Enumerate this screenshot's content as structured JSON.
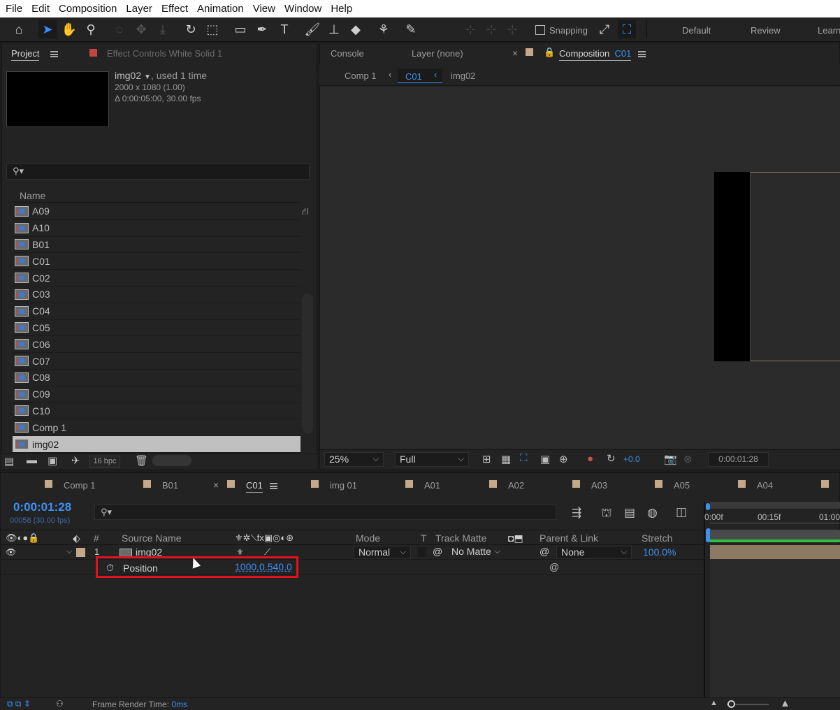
{
  "menu": [
    "File",
    "Edit",
    "Composition",
    "Layer",
    "Effect",
    "Animation",
    "View",
    "Window",
    "Help"
  ],
  "toolbar": {
    "snapping_label": "Snapping",
    "workspaces": [
      "Default",
      "Review",
      "Learn"
    ]
  },
  "project_panel": {
    "tab_label": "Project",
    "effect_controls_tab": "Effect Controls",
    "effect_controls_layer": "White Solid 1",
    "item_name": "img02",
    "item_usage": ", used 1 time",
    "item_dims": "2000 x 1080 (1.00)",
    "item_duration": "Δ 0:00:05:00, 30.00 fps",
    "name_header": "Name",
    "items": [
      "A09",
      "A10",
      "B01",
      "C01",
      "C02",
      "C03",
      "C04",
      "C05",
      "C06",
      "C07",
      "C08",
      "C09",
      "C10",
      "Comp 1",
      "img02"
    ],
    "selected_index": 14,
    "bpc_label": "16 bpc"
  },
  "viewer_panel": {
    "tabs": [
      "Console",
      "Layer (none)"
    ],
    "comp_tab_prefix": "Composition",
    "comp_tab_name": "C01",
    "breadcrumbs": [
      "Comp 1",
      "C01",
      "img02"
    ],
    "zoom": "25%",
    "resolution": "Full",
    "exposure": "+0.0",
    "timecode": "0:00:01:28"
  },
  "timeline": {
    "tabs": [
      "Comp 1",
      "B01",
      "C01",
      "img 01",
      "A01",
      "A02",
      "A03",
      "A05",
      "A04"
    ],
    "active_tab": "C01",
    "current_time": "0:00:01:28",
    "frame_info": "00058 (30.00 fps)",
    "columns": {
      "number": "#",
      "source_name": "Source Name",
      "mode": "Mode",
      "t": "T",
      "track_matte": "Track Matte",
      "parent_link": "Parent & Link",
      "stretch": "Stretch"
    },
    "layer": {
      "number": "1",
      "name": "img02",
      "mode": "Normal",
      "track_matte": "No Matte",
      "parent": "None",
      "stretch": "100.0%"
    },
    "property": {
      "label": "Position",
      "value": "1000.0,540.0"
    },
    "ruler": [
      "0:00f",
      "00:15f",
      "01:00"
    ],
    "render_time_label": "Frame Render Time:",
    "render_time_value": "0ms"
  },
  "colors": {
    "accent_blue": "#3d8ff0",
    "highlight_red": "#e0121d",
    "layer_label_tan": "#c5a88a",
    "work_area_green": "#2fbf3f"
  }
}
